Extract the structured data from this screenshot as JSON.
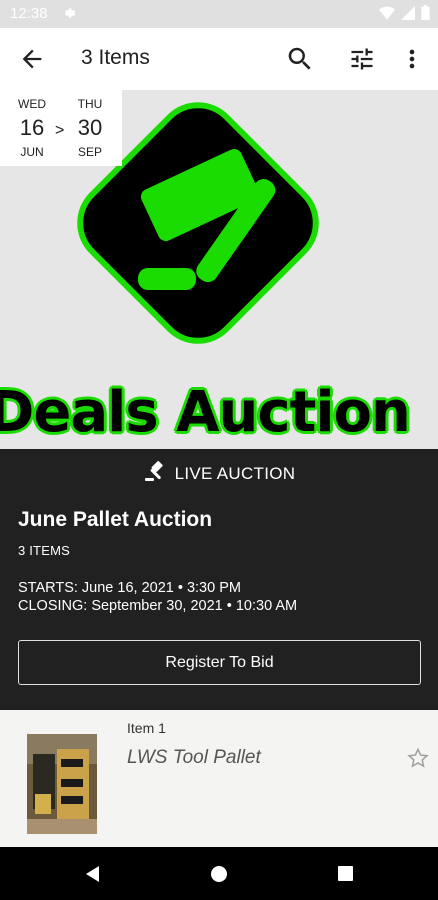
{
  "status_bar": {
    "time": "12:38",
    "icons": [
      "gear-icon",
      "wifi-icon",
      "signal-icon",
      "battery-icon"
    ]
  },
  "app_bar": {
    "title": "3 Items",
    "icons": [
      "back-arrow-icon",
      "search-icon",
      "filter-sliders-icon",
      "more-vert-icon"
    ]
  },
  "date_range": {
    "start": {
      "dow": "WED",
      "day": "16",
      "month": "JUN"
    },
    "separator": ">",
    "end": {
      "dow": "THU",
      "day": "30",
      "month": "SEP"
    }
  },
  "hero": {
    "banner_text": ": Deals Auction",
    "logo": "gavel-icon",
    "colors": {
      "accent_green": "#1bdc00",
      "logo_black": "#000000",
      "background": "#e6e6e6"
    }
  },
  "auction": {
    "live_label": "LIVE AUCTION",
    "title": "June Pallet Auction",
    "items_count": "3 ITEMS",
    "starts": "STARTS: June 16, 2021 • 3:30 PM",
    "closing": "CLOSING: September 30, 2021 • 10:30 AM",
    "register_label": "Register To Bid",
    "panel_color": "#212121"
  },
  "items": [
    {
      "number": "Item 1",
      "name": "LWS Tool Pallet",
      "favorite_icon": "star-outline-icon"
    }
  ],
  "nav_bar": {
    "icons": [
      "back-triangle-icon",
      "home-circle-icon",
      "recents-square-icon"
    ]
  }
}
